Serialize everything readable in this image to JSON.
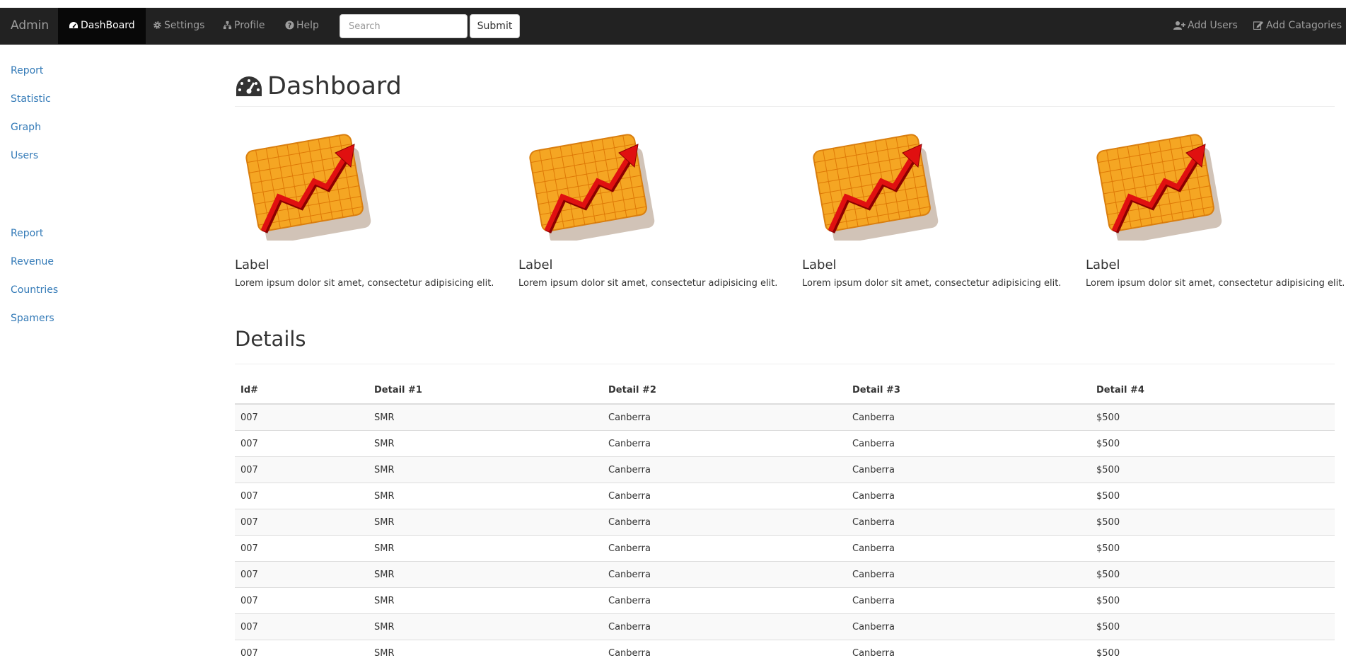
{
  "navbar": {
    "brand": "Admin",
    "items": [
      {
        "label": "DashBoard",
        "icon": "dashboard-icon",
        "active": true
      },
      {
        "label": "Settings",
        "icon": "gear-icon"
      },
      {
        "label": "Profile",
        "icon": "sitemap-icon"
      },
      {
        "label": "Help",
        "icon": "question-circle-icon"
      }
    ],
    "search_placeholder": "Search",
    "submit_label": "Submit",
    "right_items": [
      {
        "label": "Add Users",
        "icon": "user-plus-icon"
      },
      {
        "label": "Add Catagories",
        "icon": "edit-icon"
      }
    ]
  },
  "sidebar": {
    "group1": [
      "Report",
      "Statistic",
      "Graph",
      "Users"
    ],
    "group2": [
      "Report",
      "Revenue",
      "Countries",
      "Spamers"
    ]
  },
  "main": {
    "title": "Dashboard",
    "cards": [
      {
        "label": "Label",
        "text": "Lorem ipsum dolor sit amet, consectetur adipisicing elit."
      },
      {
        "label": "Label",
        "text": "Lorem ipsum dolor sit amet, consectetur adipisicing elit."
      },
      {
        "label": "Label",
        "text": "Lorem ipsum dolor sit amet, consectetur adipisicing elit."
      },
      {
        "label": "Label",
        "text": "Lorem ipsum dolor sit amet, consectetur adipisicing elit."
      }
    ],
    "details_title": "Details",
    "table": {
      "headers": [
        "Id#",
        "Detail #1",
        "Detail #2",
        "Detail #3",
        "Detail #4"
      ],
      "rows": [
        [
          "007",
          "SMR",
          "Canberra",
          "Canberra",
          "$500"
        ],
        [
          "007",
          "SMR",
          "Canberra",
          "Canberra",
          "$500"
        ],
        [
          "007",
          "SMR",
          "Canberra",
          "Canberra",
          "$500"
        ],
        [
          "007",
          "SMR",
          "Canberra",
          "Canberra",
          "$500"
        ],
        [
          "007",
          "SMR",
          "Canberra",
          "Canberra",
          "$500"
        ],
        [
          "007",
          "SMR",
          "Canberra",
          "Canberra",
          "$500"
        ],
        [
          "007",
          "SMR",
          "Canberra",
          "Canberra",
          "$500"
        ],
        [
          "007",
          "SMR",
          "Canberra",
          "Canberra",
          "$500"
        ],
        [
          "007",
          "SMR",
          "Canberra",
          "Canberra",
          "$500"
        ],
        [
          "007",
          "SMR",
          "Canberra",
          "Canberra",
          "$500"
        ]
      ]
    }
  },
  "colors": {
    "navbar_bg": "#222222",
    "active_bg": "#080808",
    "link": "#337ab7",
    "chart_orange": "#f5a623",
    "chart_arrow": "#e01010"
  }
}
